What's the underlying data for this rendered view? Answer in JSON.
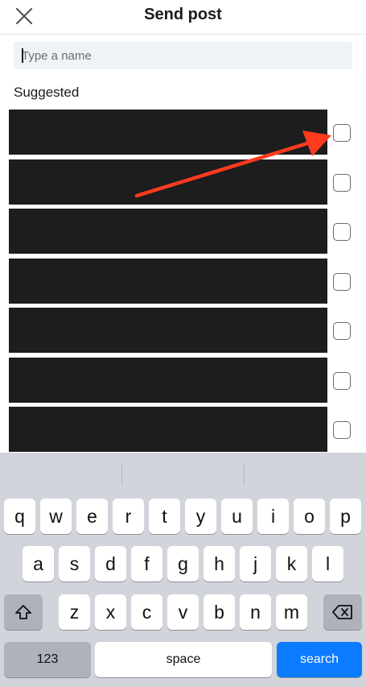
{
  "header": {
    "title": "Send post"
  },
  "search": {
    "placeholder": "Type a name",
    "value": ""
  },
  "section": {
    "label": "Suggested"
  },
  "rows": [
    {
      "checked": false
    },
    {
      "checked": false
    },
    {
      "checked": false
    },
    {
      "checked": false
    },
    {
      "checked": false
    },
    {
      "checked": false
    },
    {
      "checked": false
    }
  ],
  "annotation": {
    "color": "#ff3b1f"
  },
  "keyboard": {
    "row1": [
      "q",
      "w",
      "e",
      "r",
      "t",
      "y",
      "u",
      "i",
      "o",
      "p"
    ],
    "row2": [
      "a",
      "s",
      "d",
      "f",
      "g",
      "h",
      "j",
      "k",
      "l"
    ],
    "row3": [
      "z",
      "x",
      "c",
      "v",
      "b",
      "n",
      "m"
    ],
    "numbers_label": "123",
    "space_label": "space",
    "search_label": "search",
    "accent_color": "#0b7bff"
  }
}
